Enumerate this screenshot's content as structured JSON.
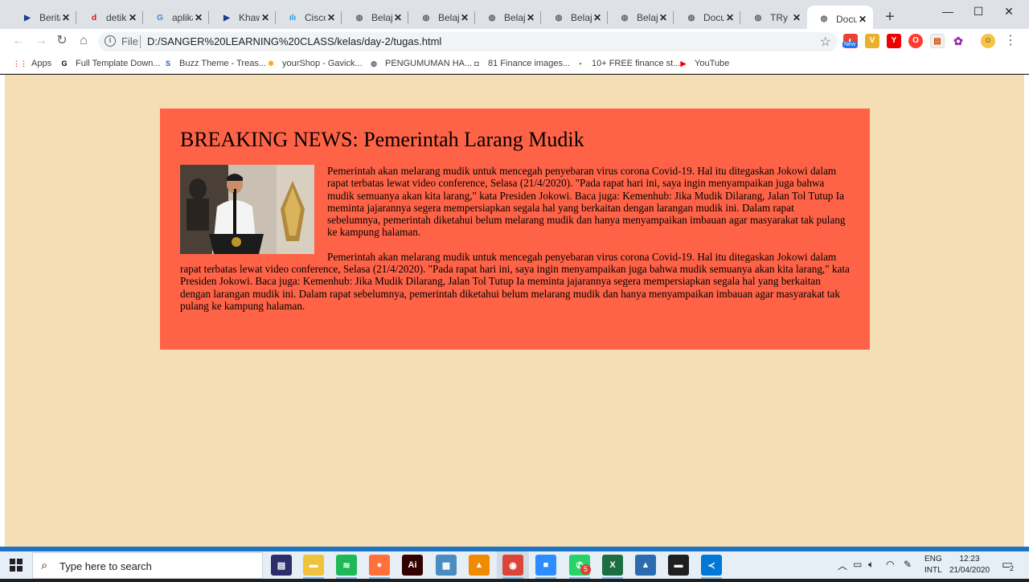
{
  "tabs": [
    {
      "title": "Berita",
      "icon": "tab-favicon-news-icon",
      "color": "#1a3c8f",
      "glyph": "▶"
    },
    {
      "title": "detikcom",
      "icon": "tab-favicon-detik-icon",
      "color": "#e30613",
      "glyph": "d"
    },
    {
      "title": "aplikasi",
      "icon": "tab-favicon-google-icon",
      "color": "#4285f4",
      "glyph": "G"
    },
    {
      "title": "Khawatir",
      "icon": "tab-favicon-news-icon",
      "color": "#1a3c8f",
      "glyph": "▶"
    },
    {
      "title": "Cisco W",
      "icon": "tab-favicon-cisco-icon",
      "color": "#1ba0d7",
      "glyph": "ılı"
    },
    {
      "title": "Belajar",
      "icon": "tab-favicon-globe-icon",
      "color": "#5f6368",
      "glyph": "◍"
    },
    {
      "title": "Belajar",
      "icon": "tab-favicon-globe-icon",
      "color": "#5f6368",
      "glyph": "◍"
    },
    {
      "title": "Belajar",
      "icon": "tab-favicon-globe-icon",
      "color": "#5f6368",
      "glyph": "◍"
    },
    {
      "title": "Belajar",
      "icon": "tab-favicon-globe-icon",
      "color": "#5f6368",
      "glyph": "◍"
    },
    {
      "title": "Belajar",
      "icon": "tab-favicon-globe-icon",
      "color": "#5f6368",
      "glyph": "◍"
    },
    {
      "title": "Document",
      "icon": "tab-favicon-globe-icon",
      "color": "#5f6368",
      "glyph": "◍"
    },
    {
      "title": "TRy CSS",
      "icon": "tab-favicon-globe-icon",
      "color": "#5f6368",
      "glyph": "◍"
    },
    {
      "title": "Document",
      "icon": "tab-favicon-globe-icon",
      "color": "#5f6368",
      "glyph": "◍",
      "active": true
    }
  ],
  "toolbar": {
    "scheme": "File",
    "url": "D:/SANGER%20LEARNING%20CLASS/kelas/day-2/tugas.html",
    "extension_new_badge": "New"
  },
  "bookmarks": [
    {
      "label": "Apps",
      "icon": "apps-grid-icon",
      "color": "#ea4335",
      "glyph": "⋮⋮"
    },
    {
      "label": "Full Template Down...",
      "icon": "bookmark-g-icon",
      "color": "#000000",
      "glyph": "G"
    },
    {
      "label": "Buzz Theme - Treas...",
      "icon": "bookmark-s-icon",
      "color": "#1e5db8",
      "glyph": "S"
    },
    {
      "label": "yourShop - Gavick...",
      "icon": "bookmark-joomla-icon",
      "color": "#f4a71d",
      "glyph": "✱"
    },
    {
      "label": "PENGUMUMAN HA...",
      "icon": "bookmark-globe-icon",
      "color": "#5f6368",
      "glyph": "◍"
    },
    {
      "label": "81 Finance images...",
      "icon": "bookmark-camera-icon",
      "color": "#3c4043",
      "glyph": "◘"
    },
    {
      "label": "10+ FREE finance st...",
      "icon": "bookmark-finance-icon",
      "color": "#5a9e2b",
      "glyph": "▪"
    },
    {
      "label": "YouTube",
      "icon": "youtube-icon",
      "color": "#ff0000",
      "glyph": "▶"
    }
  ],
  "article": {
    "heading": "BREAKING NEWS: Pemerintah Larang Mudik",
    "paragraph_1": "Pemerintah akan melarang mudik untuk mencegah penyebaran virus corona Covid-19. Hal itu ditegaskan Jokowi dalam rapat terbatas lewat video conference, Selasa (21/4/2020). \"Pada rapat hari ini, saya ingin menyampaikan juga bahwa mudik semuanya akan kita larang,\" kata Presiden Jokowi. Baca juga: Kemenhub: Jika Mudik Dilarang, Jalan Tol Tutup Ia meminta jajarannya segera mempersiapkan segala hal yang berkaitan dengan larangan mudik ini. Dalam rapat sebelumnya, pemerintah diketahui belum melarang mudik dan hanya menyampaikan imbauan agar masyarakat tak pulang ke kampung halaman.",
    "paragraph_2": "Pemerintah akan melarang mudik untuk mencegah penyebaran virus corona Covid-19. Hal itu ditegaskan Jokowi dalam rapat terbatas lewat video conference, Selasa (21/4/2020). \"Pada rapat hari ini, saya ingin menyampaikan juga bahwa mudik semuanya akan kita larang,\" kata Presiden Jokowi. Baca juga: Kemenhub: Jika Mudik Dilarang, Jalan Tol Tutup Ia meminta jajarannya segera mempersiapkan segala hal yang berkaitan dengan larangan mudik ini. Dalam rapat sebelumnya, pemerintah diketahui belum melarang mudik dan hanya menyampaikan imbauan agar masyarakat tak pulang ke kampung halaman."
  },
  "taskbar": {
    "search_placeholder": "Type here to search",
    "apps": [
      {
        "name": "vscode-alt-icon",
        "color": "#2d2d6b",
        "glyph": "▤"
      },
      {
        "name": "file-explorer-icon",
        "color": "#f0c33c",
        "glyph": "▬"
      },
      {
        "name": "spotify-icon",
        "color": "#1db954",
        "glyph": "≋"
      },
      {
        "name": "firefox-icon",
        "color": "#ff7139",
        "glyph": "●"
      },
      {
        "name": "illustrator-icon",
        "color": "#330000",
        "glyph": "Ai"
      },
      {
        "name": "photos-icon",
        "color": "#4a8bc2",
        "glyph": "▦"
      },
      {
        "name": "vlc-icon",
        "color": "#f08a00",
        "glyph": "▲"
      },
      {
        "name": "chrome-icon",
        "color": "#db4437",
        "glyph": "◉"
      },
      {
        "name": "zoom-icon",
        "color": "#2d8cff",
        "glyph": "■"
      },
      {
        "name": "whatsapp-icon",
        "color": "#25d366",
        "glyph": "✆"
      },
      {
        "name": "excel-icon",
        "color": "#1d6f42",
        "glyph": "X"
      },
      {
        "name": "image-viewer-icon",
        "color": "#2b6cb0",
        "glyph": "▲"
      },
      {
        "name": "terminal-icon",
        "color": "#1f1f1f",
        "glyph": "▬"
      },
      {
        "name": "vscode-icon",
        "color": "#0078d7",
        "glyph": "≺"
      }
    ],
    "whatsapp_badge": "5",
    "lang_top": "ENG",
    "lang_bottom": "INTL",
    "time": "12:23",
    "date": "21/04/2020",
    "notification_count": "2"
  }
}
